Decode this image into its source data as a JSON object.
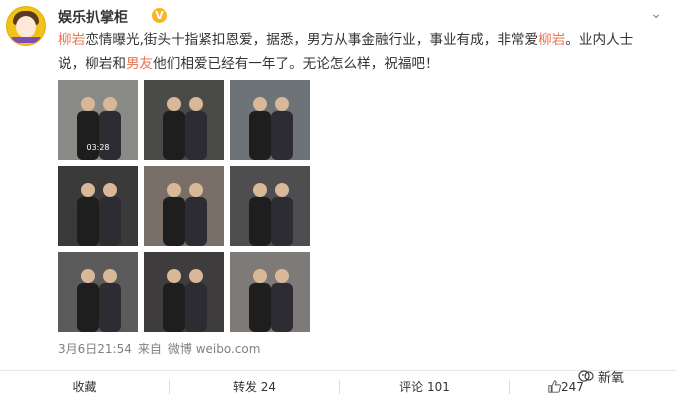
{
  "user": {
    "name": "娱乐扒掌柜"
  },
  "post": {
    "segments": [
      {
        "t": "柳岩",
        "hl": true
      },
      {
        "t": "恋情曝光,街头十指紧扣恩爱，据悉，男方从事金融行业，事业有成，非常爱",
        "hl": false
      },
      {
        "t": "柳岩",
        "hl": true
      },
      {
        "t": "。业内人士说，柳岩和",
        "hl": false
      },
      {
        "t": "男友",
        "hl": true
      },
      {
        "t": "他们相爱已经有一年了。无论怎么样，祝福吧！",
        "hl": false
      }
    ],
    "photos": [
      {
        "bg": "#8a8a86",
        "caption": "03:28"
      },
      {
        "bg": "#4a4a48",
        "caption": ""
      },
      {
        "bg": "#6e7378",
        "caption": ""
      },
      {
        "bg": "#3a3a3a",
        "caption": ""
      },
      {
        "bg": "#7a6f66",
        "caption": ""
      },
      {
        "bg": "#4e4e50",
        "caption": ""
      },
      {
        "bg": "#5b5b5b",
        "caption": ""
      },
      {
        "bg": "#3e3c3c",
        "caption": ""
      },
      {
        "bg": "#7d7a78",
        "caption": ""
      }
    ],
    "time": "3月6日21:54",
    "source_label": "来自",
    "source": "微博 weibo.com"
  },
  "actions": {
    "collect": "收藏",
    "repost": "转发 24",
    "comment": "评论 101",
    "like": "247"
  },
  "watermark": "新氧",
  "colors": {
    "highlight": "#eb7350",
    "badge": "#f8b624"
  }
}
